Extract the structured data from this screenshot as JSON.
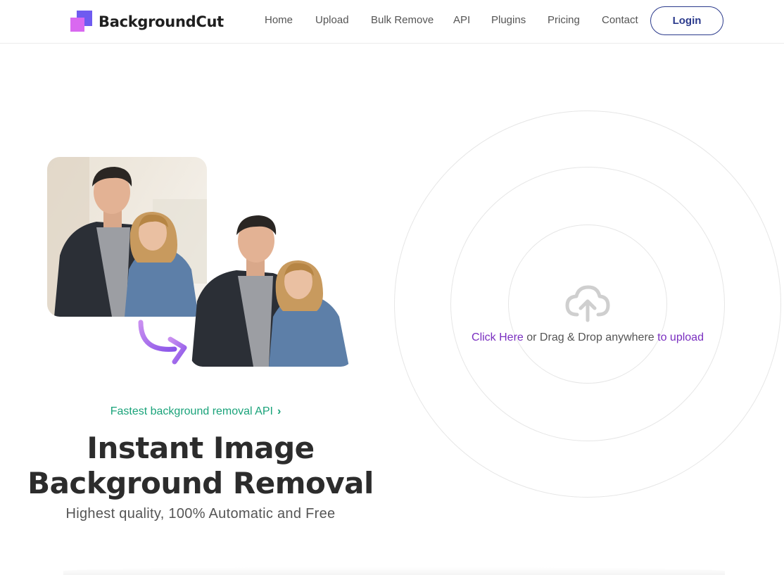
{
  "brand": {
    "name": "BackgroundCut"
  },
  "nav": {
    "items": [
      "Home",
      "Upload",
      "Bulk Remove",
      "API",
      "Plugins",
      "Pricing",
      "Contact"
    ],
    "login_label": "Login"
  },
  "hero": {
    "tagline": "Fastest background removal API",
    "title_line1": "Instant Image",
    "title_line2": "Background Removal",
    "subtitle": "Highest quality, 100% Automatic and Free"
  },
  "upload": {
    "click_label": "Click Here",
    "middle_text": " or Drag & Drop anywhere ",
    "end_label": "to upload",
    "icon": "cloud-upload-icon"
  },
  "colors": {
    "accent_green": "#1aa37a",
    "accent_purple": "#7a2fc0",
    "login_blue": "#2b3a8c",
    "logo_violet": "#6f5bf0",
    "logo_pink": "#d968f0"
  }
}
